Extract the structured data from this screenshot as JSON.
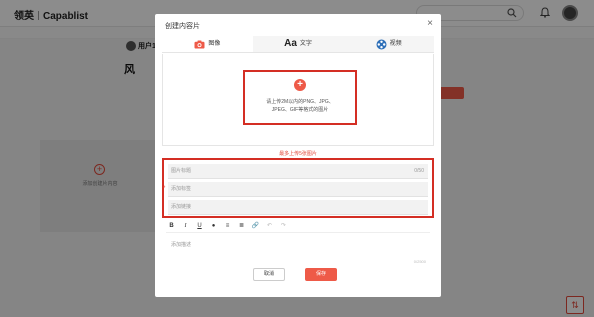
{
  "app": {
    "brand_cn": "领英",
    "brand_en": "Capablist"
  },
  "background": {
    "user_name": "用户1",
    "headline": "风",
    "add_card_label": "添加创建片内容"
  },
  "modal": {
    "title": "创建内容片",
    "close_label": "×",
    "tabs": [
      {
        "label": "图像",
        "icon": "camera-icon",
        "active": true
      },
      {
        "label": "文字",
        "icon": "text-icon",
        "glyph": "Aa",
        "active": false
      },
      {
        "label": "视频",
        "icon": "video-reel-icon",
        "active": false
      }
    ],
    "upload": {
      "hint_line1": "请上传2M以内的PNG、JPG、",
      "hint_line2": "JPEG、GIF等格式的图片"
    },
    "limit_note": "最多上传5张图片",
    "fields": {
      "title_placeholder": "图片标题",
      "title_counter": "0/50",
      "tag_placeholder": "添加标签",
      "link_placeholder": "添加链接"
    },
    "editor": {
      "toolbar": [
        "B",
        "I",
        "U",
        "●",
        "≡",
        "≣",
        "🔗",
        "↶",
        "↷"
      ],
      "desc_placeholder": "添加描述",
      "desc_counter": "0/2500"
    },
    "buttons": {
      "cancel": "取消",
      "save": "保存"
    }
  },
  "colors": {
    "accent": "#ee5a48",
    "highlight_border": "#d42e24"
  }
}
